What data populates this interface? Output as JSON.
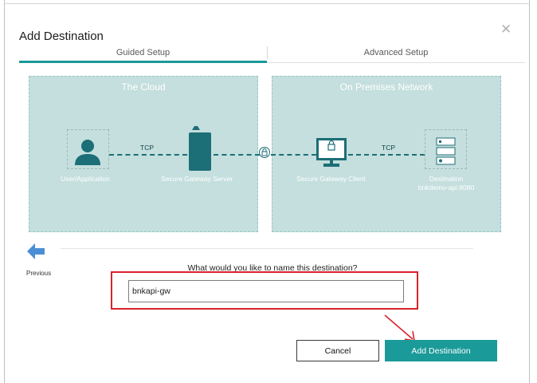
{
  "dialog": {
    "title": "Add Destination",
    "close_icon": "close-icon"
  },
  "tabs": [
    {
      "label": "Guided Setup",
      "active": true
    },
    {
      "label": "Advanced Setup",
      "active": false
    }
  ],
  "diagram": {
    "cloud": {
      "title": "The Cloud",
      "user_label": "User/Application",
      "tcp_label": "TCP",
      "server_label": "Secure Gateway Server"
    },
    "onprem": {
      "title": "On Premises Network",
      "client_label": "Secure Gateway Client",
      "tcp_label": "TCP",
      "destination_label": "Destination",
      "destination_value": "bnkdemo-api:8080"
    }
  },
  "navigation": {
    "previous_label": "Previous"
  },
  "form": {
    "question": "What would you like to name this destination?",
    "name_value": "bnkapi-gw"
  },
  "buttons": {
    "cancel": "Cancel",
    "add": "Add Destination"
  },
  "colors": {
    "accent": "#1a9a98",
    "panel": "#c4dfdd",
    "diagram_dark": "#1c6e77",
    "annotation": "#d9232a",
    "back_arrow": "#4a8fd6"
  }
}
